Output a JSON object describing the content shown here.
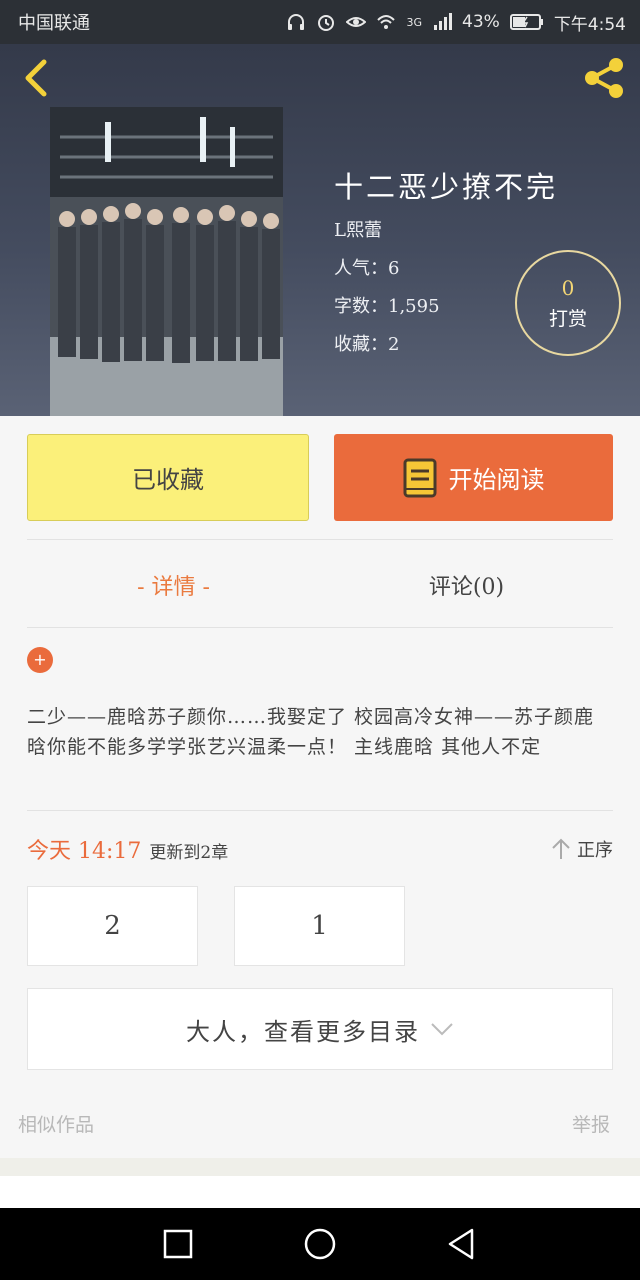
{
  "status_bar": {
    "carrier": "中国联通",
    "network": "3G",
    "battery": "43%",
    "time": "下午4:54"
  },
  "book": {
    "title": "十二恶少撩不完",
    "author": "L熙蕾",
    "popularity": "人气：6",
    "word_count": "字数：1,595",
    "favorites": "收藏：2",
    "reward_count": "0",
    "reward_label": "打赏"
  },
  "actions": {
    "collected_label": "已收藏",
    "read_label": "开始阅读"
  },
  "tabs": [
    {
      "label": "- 详情 -",
      "active": true
    },
    {
      "label": "评论(0)",
      "active": false
    }
  ],
  "description": "二少——鹿晗苏子颜你……我娶定了 校园高冷女神——苏子颜鹿晗你能不能多学学张艺兴温柔一点！ 主线鹿晗 其他人不定",
  "update": {
    "time": "今天 14:17",
    "text": "更新到2章",
    "order_label": "正序"
  },
  "chapters": [
    "2",
    "1"
  ],
  "more_label": "大人，查看更多目录",
  "footer": {
    "similar": "相似作品",
    "report": "举报"
  },
  "colors": {
    "accent": "#ea6b3c",
    "collected_bg": "#fbf07a",
    "icon_yellow": "#f3d13a"
  }
}
